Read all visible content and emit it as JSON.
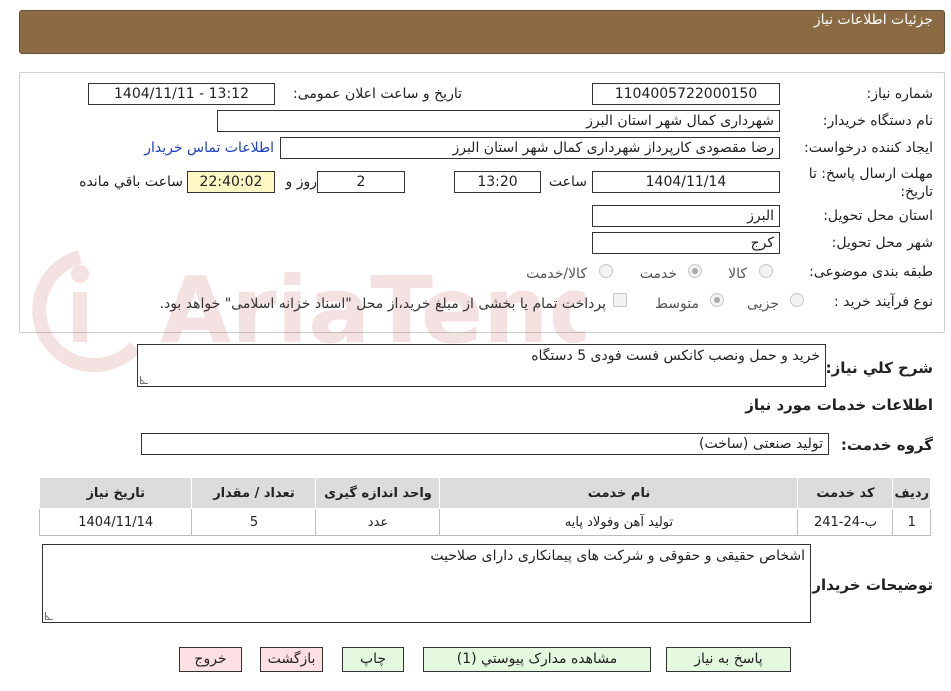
{
  "header": {
    "title": "جزئیات اطلاعات نیاز"
  },
  "form": {
    "need_number_label": "شماره نیاز:",
    "need_number": "1104005722000150",
    "announce_label": "تاریخ و ساعت اعلان عمومی:",
    "announce_value": "1404/11/11 - 13:12",
    "buyer_org_label": "نام دستگاه خریدار:",
    "buyer_org": "شهرداری کمال شهر استان البرز",
    "creator_label": "ایجاد کننده درخواست:",
    "creator": "رضا مقصودی کارپرداز شهرداری کمال شهر استان البرز",
    "contact_link": "اطلاعات تماس خریدار",
    "deadline_label_line1": "مهلت ارسال پاسخ: تا",
    "deadline_label_line2": "تاریخ:",
    "deadline_date": "1404/11/14",
    "time_label": "ساعت",
    "deadline_time": "13:20",
    "days": "2",
    "days_label": "روز و",
    "remaining": "22:40:02",
    "remaining_label": "ساعت باقي مانده",
    "province_label": "استان محل تحویل:",
    "province": "البرز",
    "city_label": "شهر محل تحویل:",
    "city": "کرج",
    "category_label": "طبقه بندی موضوعی:",
    "category_options": [
      "کالا",
      "خدمت",
      "کالا/خدمت"
    ],
    "category_selected": "خدمت",
    "process_label": "نوع فرآیند خرید :",
    "process_options": [
      "جزیی",
      "متوسط"
    ],
    "process_selected": "متوسط",
    "payment_note": "پرداخت تمام یا بخشی از مبلغ خرید،از محل \"اسناد خزانه اسلامی\" خواهد بود."
  },
  "description": {
    "label": "شرح کلي نیاز:",
    "value": "خرید و حمل ونصب کانکس فست فودی 5 دستگاه"
  },
  "services": {
    "section_title": "اطلاعات خدمات مورد نیاز",
    "group_label": "گروه خدمت:",
    "group_value": "تولید صنعتی (ساخت)",
    "columns": [
      "ردیف",
      "کد خدمت",
      "نام خدمت",
      "واحد اندازه گیری",
      "تعداد / مقدار",
      "تاریخ نیاز"
    ],
    "rows": [
      [
        "1",
        "ب-24-241",
        "تولید آهن وفولاد پایه",
        "عدد",
        "5",
        "1404/11/14"
      ]
    ]
  },
  "buyer_notes": {
    "label": "توضیحات خریدار:",
    "value": "اشخاص حقیقی و حقوقی  و شرکت های پیمانکاری دارای صلاحیت"
  },
  "buttons": {
    "reply": "پاسخ به نیاز",
    "attachments": "مشاهده مدارک پیوستي (1)",
    "print": "چاپ",
    "back": "بازگشت",
    "exit": "خروج"
  },
  "watermark": {
    "text": "AriaTender.neT"
  },
  "colors": {
    "header": "#8b6b43",
    "button_green": "#e4f7df",
    "button_pink": "#fde0e4",
    "remaining_bg": "#fff7c4",
    "link": "#1a3fc7"
  }
}
